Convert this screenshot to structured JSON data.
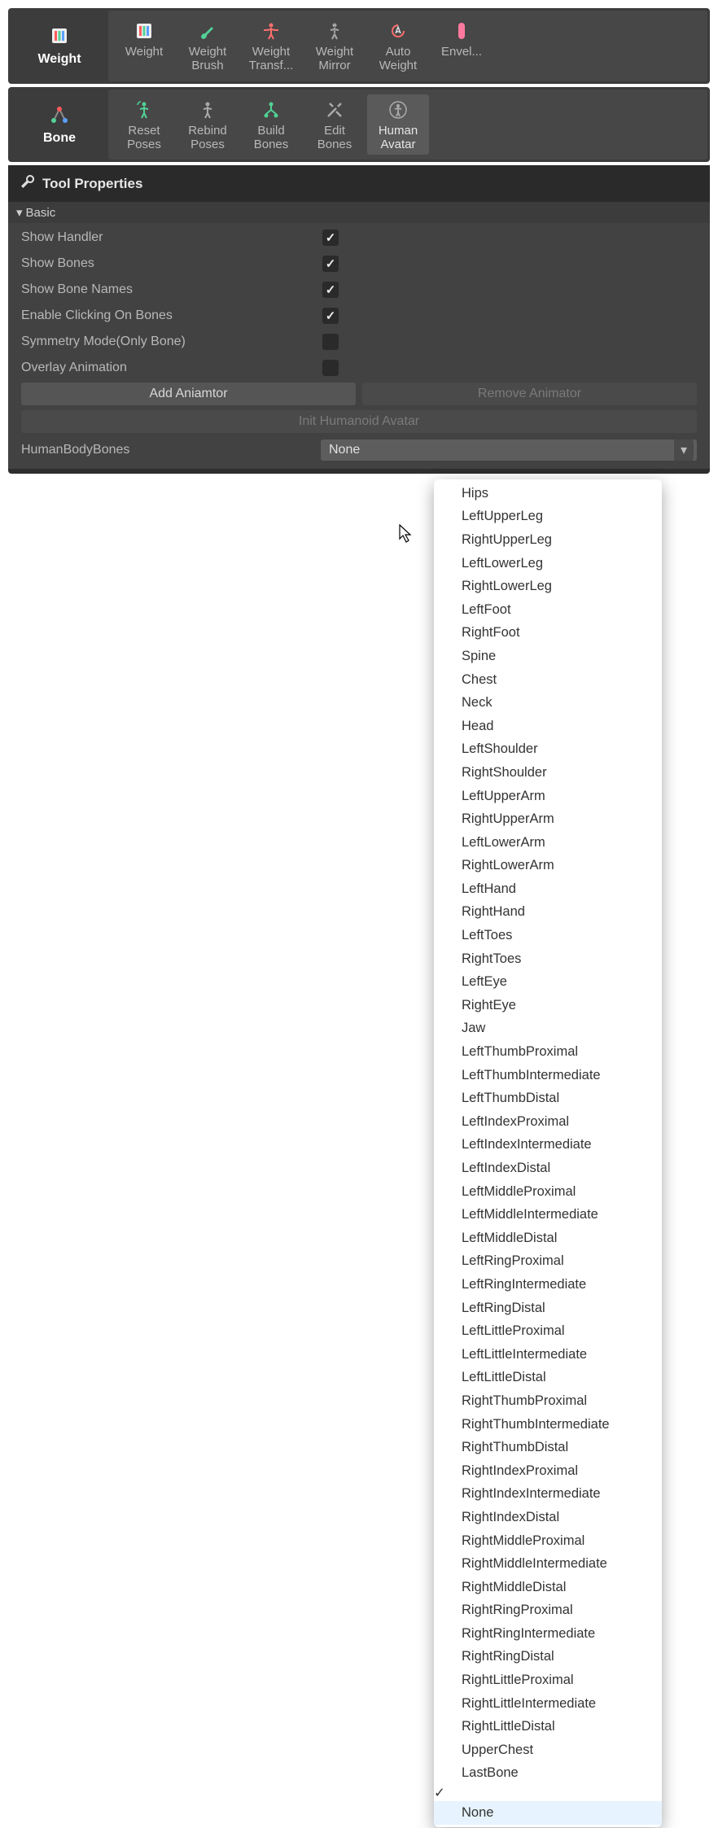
{
  "weight_panel": {
    "mode_label": "Weight",
    "tools": [
      {
        "label": "Weight",
        "icon": "sliders",
        "color": "#ff6e6e"
      },
      {
        "label": "Weight Brush",
        "icon": "brush",
        "color": "#52d296"
      },
      {
        "label": "Weight Transf...",
        "icon": "person-arrows",
        "color": "#ff6e6e"
      },
      {
        "label": "Weight Mirror",
        "icon": "person-mirror",
        "color": "#aaa"
      },
      {
        "label": "Auto Weight",
        "icon": "auto",
        "color": "#ff6e6e"
      },
      {
        "label": "Envel...",
        "icon": "capsule",
        "color": "#ff7a9e"
      }
    ]
  },
  "bone_panel": {
    "mode_label": "Bone",
    "tools": [
      {
        "label": "Reset Poses",
        "icon": "reset",
        "color": "#52d296"
      },
      {
        "label": "Rebind Poses",
        "icon": "person",
        "color": "#aaa"
      },
      {
        "label": "Build Bones",
        "icon": "hierarchy",
        "color": "#52d296"
      },
      {
        "label": "Edit Bones",
        "icon": "tools",
        "color": "#aaa"
      },
      {
        "label": "Human Avatar",
        "icon": "human",
        "color": "#aaa",
        "active": true
      }
    ]
  },
  "props": {
    "title": "Tool Properties",
    "section": "Basic",
    "rows": [
      {
        "label": "Show Handler",
        "checked": true
      },
      {
        "label": "Show Bones",
        "checked": true
      },
      {
        "label": "Show Bone Names",
        "checked": true
      },
      {
        "label": "Enable Clicking On Bones",
        "checked": true
      },
      {
        "label": "Symmetry Mode(Only Bone)",
        "checked": false
      },
      {
        "label": "Overlay Animation",
        "checked": false
      }
    ],
    "add_btn": "Add Aniamtor",
    "remove_btn": "Remove Animator",
    "init_btn": "Init Humanoid Avatar",
    "field_label": "HumanBodyBones",
    "field_value": "None"
  },
  "dropdown_items": [
    "Hips",
    "LeftUpperLeg",
    "RightUpperLeg",
    "LeftLowerLeg",
    "RightLowerLeg",
    "LeftFoot",
    "RightFoot",
    "Spine",
    "Chest",
    "Neck",
    "Head",
    "LeftShoulder",
    "RightShoulder",
    "LeftUpperArm",
    "RightUpperArm",
    "LeftLowerArm",
    "RightLowerArm",
    "LeftHand",
    "RightHand",
    "LeftToes",
    "RightToes",
    "LeftEye",
    "RightEye",
    "Jaw",
    "LeftThumbProximal",
    "LeftThumbIntermediate",
    "LeftThumbDistal",
    "LeftIndexProximal",
    "LeftIndexIntermediate",
    "LeftIndexDistal",
    "LeftMiddleProximal",
    "LeftMiddleIntermediate",
    "LeftMiddleDistal",
    "LeftRingProximal",
    "LeftRingIntermediate",
    "LeftRingDistal",
    "LeftLittleProximal",
    "LeftLittleIntermediate",
    "LeftLittleDistal",
    "RightThumbProximal",
    "RightThumbIntermediate",
    "RightThumbDistal",
    "RightIndexProximal",
    "RightIndexIntermediate",
    "RightIndexDistal",
    "RightMiddleProximal",
    "RightMiddleIntermediate",
    "RightMiddleDistal",
    "RightRingProximal",
    "RightRingIntermediate",
    "RightRingDistal",
    "RightLittleProximal",
    "RightLittleIntermediate",
    "RightLittleDistal",
    "UpperChest",
    "LastBone",
    "None"
  ],
  "dropdown_selected": "None"
}
